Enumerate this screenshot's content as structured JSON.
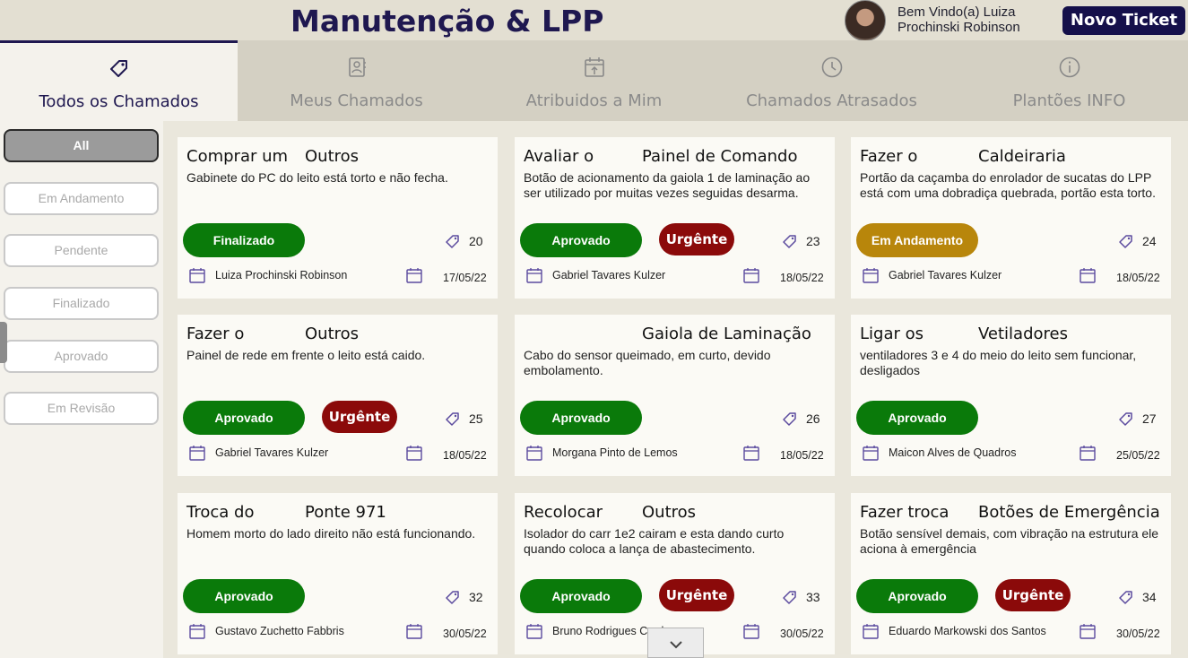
{
  "header": {
    "title": "Manutenção & LPP",
    "welcome_line1": "Bem Vindo(a) Luiza",
    "welcome_line2": "Prochinski Robinson",
    "new_ticket_label": "Novo Ticket"
  },
  "tabs": [
    {
      "label": "Todos os Chamados",
      "icon": "tag-icon",
      "active": true
    },
    {
      "label": "Meus Chamados",
      "icon": "contact-book-icon",
      "active": false
    },
    {
      "label": "Atribuidos a Mim",
      "icon": "calendar-assign-icon",
      "active": false
    },
    {
      "label": "Chamados Atrasados",
      "icon": "clock-icon",
      "active": false
    },
    {
      "label": "Plantões INFO",
      "icon": "info-icon",
      "active": false
    }
  ],
  "filters": [
    {
      "label": "All",
      "active": true
    },
    {
      "label": "Em Andamento",
      "active": false
    },
    {
      "label": "Pendente",
      "active": false
    },
    {
      "label": "Finalizado",
      "active": false
    },
    {
      "label": "Aprovado",
      "active": false
    },
    {
      "label": "Em Revisão",
      "active": false
    }
  ],
  "colors": {
    "brand_dark": "#1f1850",
    "status_green": "#0a7a0a",
    "status_gold": "#b8860b",
    "urgent_red": "#8b0a0a",
    "icon_purple": "#5b4a9e"
  },
  "tickets": [
    {
      "title_a": "Comprar um",
      "title_b": "Outros",
      "description": "Gabinete do PC do leito está torto e não fecha.",
      "status": "Finalizado",
      "urgent": "",
      "number": "20",
      "assignee": "Luiza Prochinski Robinson",
      "date": "17/05/22"
    },
    {
      "title_a": "Avaliar o",
      "title_b": "Painel de Comando",
      "description": "Botão de acionamento da gaiola 1 de laminação ao ser utilizado por muitas vezes seguidas desarma.",
      "status": "Aprovado",
      "urgent": "Urgênte",
      "number": "23",
      "assignee": "Gabriel Tavares Kulzer",
      "date": "18/05/22"
    },
    {
      "title_a": "Fazer o",
      "title_b": "Caldeiraria",
      "description": "Portão da caçamba do enrolador de sucatas do LPP está com uma dobradiça quebrada, portão esta torto.",
      "status": "Em Andamento",
      "urgent": "",
      "number": "24",
      "assignee": "Gabriel Tavares Kulzer",
      "date": "18/05/22"
    },
    {
      "title_a": "Fazer o",
      "title_b": "Outros",
      "description": "Painel de rede em frente o leito está caido.",
      "status": "Aprovado",
      "urgent": "Urgênte",
      "number": "25",
      "assignee": "Gabriel Tavares Kulzer",
      "date": "18/05/22"
    },
    {
      "title_a": "",
      "title_b": "Gaiola de Laminação",
      "description": "Cabo do sensor queimado, em curto, devido embolamento.",
      "status": "Aprovado",
      "urgent": "",
      "number": "26",
      "assignee": "Morgana Pinto de Lemos",
      "date": "18/05/22"
    },
    {
      "title_a": "Ligar os",
      "title_b": "Vetiladores",
      "description": "ventiladores 3 e 4 do meio do leito sem funcionar, desligados",
      "status": "Aprovado",
      "urgent": "",
      "number": "27",
      "assignee": "Maicon Alves de Quadros",
      "date": "25/05/22"
    },
    {
      "title_a": "Troca do",
      "title_b": "Ponte 971",
      "description": "Homem morto do lado direito não está funcionando.",
      "status": "Aprovado",
      "urgent": "",
      "number": "32",
      "assignee": "Gustavo Zuchetto Fabbris",
      "date": "30/05/22"
    },
    {
      "title_a": "Recolocar",
      "title_b": "Outros",
      "description": "Isolador do carr 1e2 cairam e esta dando curto quando coloca a lança de abastecimento.",
      "status": "Aprovado",
      "urgent": "Urgênte",
      "number": "33",
      "assignee": "Bruno Rodrigues Cardoso",
      "date": "30/05/22"
    },
    {
      "title_a": "Fazer troca",
      "title_b": "Botões de Emergência",
      "description": "Botão sensível demais, com vibração na estrutura ele aciona à emergência",
      "status": "Aprovado",
      "urgent": "Urgênte",
      "number": "34",
      "assignee": "Eduardo Markowski dos Santos",
      "date": "30/05/22"
    }
  ]
}
